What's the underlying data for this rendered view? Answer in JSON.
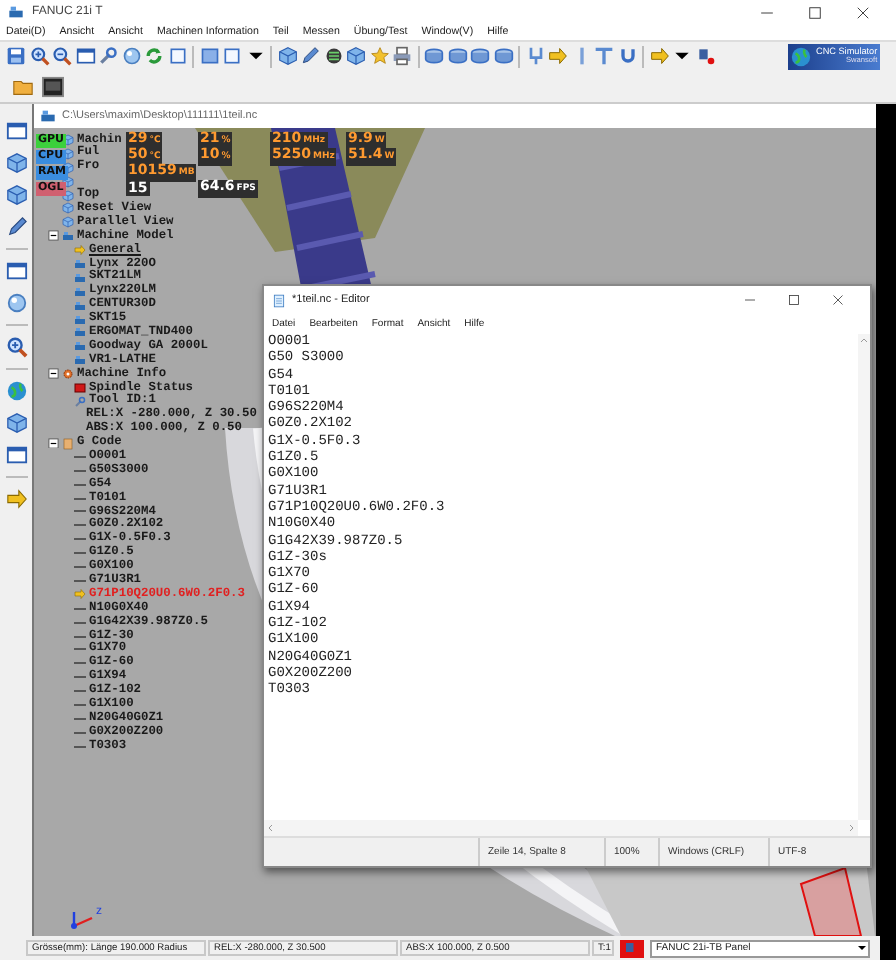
{
  "window": {
    "title": "FANUC 21i T"
  },
  "menu": [
    "Datei(D)",
    "Ansicht",
    "Ansicht",
    "Machinen Information",
    "Teil",
    "Messen",
    "Übung/Test",
    "Window(V)",
    "Hilfe"
  ],
  "logo": {
    "title": "CNC Simulator",
    "subtitle": "Swansoft"
  },
  "document": {
    "path": "C:\\Users\\maxim\\Desktop\\111111\\1teil.nc"
  },
  "monitor": [
    {
      "label": "GPU",
      "kind": "sensor",
      "color": "#3cd03c",
      "readings": [
        {
          "value": "29",
          "unit": "°C"
        },
        {
          "value": "21",
          "unit": "%"
        },
        {
          "value": "210",
          "unit": "MHz"
        },
        {
          "value": "9.9",
          "unit": "W"
        }
      ]
    },
    {
      "label": "CPU",
      "kind": "sensor",
      "color": "#3a8de0",
      "readings": [
        {
          "value": "50",
          "unit": "°C"
        },
        {
          "value": "10",
          "unit": "%"
        },
        {
          "value": "5250",
          "unit": "MHz"
        },
        {
          "value": "51.4",
          "unit": "W"
        }
      ]
    },
    {
      "label": "RAM",
      "kind": "sensor",
      "color": "#3a8de0",
      "readings": [
        {
          "value": "10159",
          "unit": "MB"
        }
      ]
    },
    {
      "label": "OGL",
      "kind": "fps",
      "color": "#d06070",
      "readings": [
        {
          "value": "15"
        },
        {
          "value": "64.6",
          "unit": "FPS"
        }
      ]
    }
  ],
  "tree": [
    {
      "label": "Machin",
      "kind": "view"
    },
    {
      "label": "Ful",
      "kind": "view"
    },
    {
      "label": "Fro",
      "kind": "view"
    },
    {
      "kind": "view"
    },
    {
      "label": "Top",
      "kind": "view"
    },
    {
      "label": "Reset View",
      "kind": "view"
    },
    {
      "label": "Parallel View",
      "kind": "view"
    },
    {
      "label": "Machine Model",
      "kind": "folder",
      "expanded": true,
      "children": [
        {
          "label": "General",
          "kind": "machine",
          "selected": true
        },
        {
          "label": "Lynx 220O",
          "kind": "machine",
          "selected": false
        },
        {
          "label": "SKT21LM",
          "kind": "machine",
          "selected": false
        },
        {
          "label": "Lynx220LM",
          "kind": "machine",
          "selected": false
        },
        {
          "label": "CENTUR30D",
          "kind": "machine",
          "selected": false
        },
        {
          "label": "SKT15",
          "kind": "machine",
          "selected": false
        },
        {
          "label": "ERGOMAT_TND400",
          "kind": "machine",
          "selected": false
        },
        {
          "label": "Goodway GA 2000L",
          "kind": "machine",
          "selected": false
        },
        {
          "label": "VR1-LATHE",
          "kind": "machine",
          "selected": false
        }
      ]
    },
    {
      "label": "Machine Info",
      "kind": "info",
      "expanded": true,
      "children": [
        {
          "label": "Spindle Status",
          "kind": "spindle"
        },
        {
          "label": "Tool ID:1",
          "kind": "tool",
          "children": [
            {
              "label": "REL:X -280.000, Z 30.50"
            },
            {
              "label": "ABS:X 100.000, Z 0.50"
            }
          ]
        }
      ]
    },
    {
      "label": "G Code",
      "kind": "gcode",
      "expanded": true,
      "children": [
        {
          "label": "O0001",
          "kind": "line",
          "selected": false
        },
        {
          "label": "G50S3000",
          "kind": "line",
          "selected": false
        },
        {
          "label": "G54",
          "kind": "line",
          "selected": false
        },
        {
          "label": "T0101",
          "kind": "line",
          "selected": false
        },
        {
          "label": "G96S220M4",
          "kind": "line",
          "selected": false
        },
        {
          "label": "G0Z0.2X102",
          "kind": "line",
          "selected": false
        },
        {
          "label": "G1X-0.5F0.3",
          "kind": "line",
          "selected": false
        },
        {
          "label": "G1Z0.5",
          "kind": "line",
          "selected": false
        },
        {
          "label": "G0X100",
          "kind": "line",
          "selected": false
        },
        {
          "label": "G71U3R1",
          "kind": "line",
          "selected": false
        },
        {
          "label": "G71P10Q20U0.6W0.2F0.3",
          "kind": "line",
          "selected": true
        },
        {
          "label": "N10G0X40",
          "kind": "line",
          "selected": false
        },
        {
          "label": "G1G42X39.987Z0.5",
          "kind": "line",
          "selected": false
        },
        {
          "label": "G1Z-30",
          "kind": "line",
          "selected": false
        },
        {
          "label": "G1X70",
          "kind": "line",
          "selected": false
        },
        {
          "label": "G1Z-60",
          "kind": "line",
          "selected": false
        },
        {
          "label": "G1X94",
          "kind": "line",
          "selected": false
        },
        {
          "label": "G1Z-102",
          "kind": "line",
          "selected": false
        },
        {
          "label": "G1X100",
          "kind": "line",
          "selected": false
        },
        {
          "label": "N20G40G0Z1",
          "kind": "line",
          "selected": false
        },
        {
          "label": "G0X200Z200",
          "kind": "line",
          "selected": false
        },
        {
          "label": "T0303",
          "kind": "line",
          "selected": false
        }
      ]
    }
  ],
  "axis_label": "z",
  "notepad": {
    "title": "*1teil.nc - Editor",
    "menu": [
      "Datei",
      "Bearbeiten",
      "Format",
      "Ansicht",
      "Hilfe"
    ],
    "lines": [
      "O0001",
      "G50 S3000",
      "G54",
      "T0101",
      "G96S220M4",
      "G0Z0.2X102",
      "G1X-0.5F0.3",
      "G1Z0.5",
      "G0X100",
      "G71U3R1",
      "G71P10Q20U0.6W0.2F0.3",
      "N10G0X40",
      "G1G42X39.987Z0.5",
      "G1Z-30s",
      "G1X70",
      "G1Z-60",
      "G1X94",
      "G1Z-102",
      "G1X100",
      "N20G40G0Z1",
      "G0X200Z200",
      "T0303"
    ],
    "status": [
      "Zeile 14, Spalte 8",
      "100%",
      "Windows (CRLF)",
      "UTF-8"
    ]
  },
  "status_bar": {
    "size": "Grösse(mm): Länge 190.000 Radius",
    "rel": "REL:X -280.000, Z  30.500",
    "abs": "ABS:X 100.000, Z  0.500",
    "tool": "T:1",
    "panel": "FANUC 21i-TB Panel"
  }
}
